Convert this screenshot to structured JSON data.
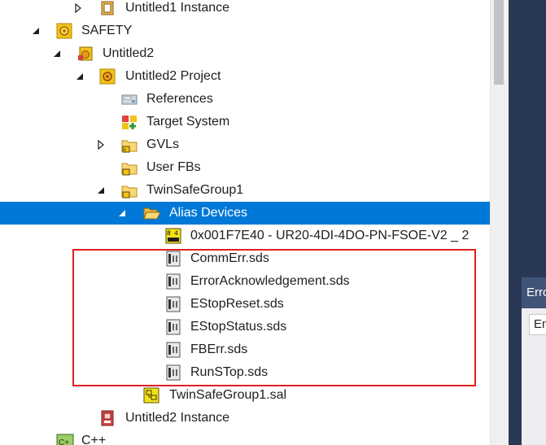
{
  "tree": {
    "items": [
      {
        "label": "Untitled1 Instance",
        "expander": "collapsed",
        "icon": "instance-icon"
      },
      {
        "label": "SAFETY",
        "expander": "expanded",
        "icon": "safety-gear-icon"
      },
      {
        "label": "Untitled2",
        "expander": "expanded",
        "icon": "safety-project-icon"
      },
      {
        "label": "Untitled2 Project",
        "expander": "expanded",
        "icon": "project-gear-icon"
      },
      {
        "label": "References",
        "expander": "none",
        "icon": "references-icon"
      },
      {
        "label": "Target System",
        "expander": "none",
        "icon": "target-system-icon"
      },
      {
        "label": "GVLs",
        "expander": "collapsed",
        "icon": "gvl-folder-icon"
      },
      {
        "label": "User FBs",
        "expander": "none",
        "icon": "user-fb-folder-icon"
      },
      {
        "label": "TwinSafeGroup1",
        "expander": "expanded",
        "icon": "group-folder-icon"
      },
      {
        "label": "Alias Devices",
        "expander": "expanded",
        "icon": "open-folder-icon"
      },
      {
        "label": "0x001F7E40 - UR20-4DI-4DO-PN-FSOE-V2 _ 2",
        "expander": "none",
        "icon": "io-device-icon"
      },
      {
        "label": "CommErr.sds",
        "expander": "none",
        "icon": "sds-file-icon"
      },
      {
        "label": "ErrorAcknowledgement.sds",
        "expander": "none",
        "icon": "sds-file-icon"
      },
      {
        "label": "EStopReset.sds",
        "expander": "none",
        "icon": "sds-file-icon"
      },
      {
        "label": "EStopStatus.sds",
        "expander": "none",
        "icon": "sds-file-icon"
      },
      {
        "label": "FBErr.sds",
        "expander": "none",
        "icon": "sds-file-icon"
      },
      {
        "label": "RunSTop.sds",
        "expander": "none",
        "icon": "sds-file-icon"
      },
      {
        "label": "TwinSafeGroup1.sal",
        "expander": "none",
        "icon": "sal-file-icon"
      },
      {
        "label": "Untitled2 Instance",
        "expander": "none",
        "icon": "safety-instance-icon"
      },
      {
        "label": "C++",
        "expander": "none",
        "icon": "cpp-icon"
      }
    ]
  },
  "error_panel": {
    "title": "Erro",
    "field": "En"
  },
  "colors": {
    "selection": "#0078d7",
    "highlight_border": "#e02020",
    "dark_pane": "#293955"
  }
}
